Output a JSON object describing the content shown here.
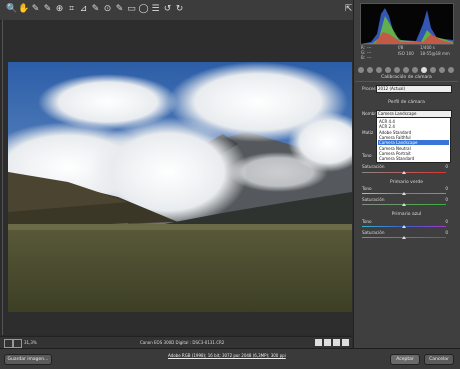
{
  "toolbar": {
    "tools": [
      "zoom-tool",
      "hand-tool",
      "white-balance-tool",
      "color-sampler-tool",
      "targeted-adjustment-tool",
      "crop-tool",
      "straighten-tool",
      "spot-removal-tool",
      "red-eye-tool",
      "adjustment-brush-tool",
      "graduated-filter-tool",
      "radial-filter-tool",
      "preferences-tool",
      "rotate-ccw-tool",
      "rotate-cw-tool"
    ],
    "tool_glyphs": [
      "🔍",
      "✋",
      "✎",
      "✎",
      "⊕",
      "⌗",
      "⊿",
      "✎",
      "⊙",
      "✎",
      "▭",
      "◯",
      "☰",
      "↺",
      "↻"
    ]
  },
  "histogram": {
    "r_label": "R:",
    "g_label": "G:",
    "b_label": "B:",
    "r_value": "---",
    "g_value": "---",
    "b_value": "---",
    "f_value": "f/8",
    "iso_value": "ISO 100",
    "shutter_value": "1/400 s",
    "focal_value": "18-55@18 mm"
  },
  "panel": {
    "section_title": "Calibración de cámara",
    "process_label": "Proceso:",
    "process_value": "2012 (Actual)",
    "profile_title": "Perfil de cámara",
    "name_label": "Nombre:",
    "name_value": "Camera Landscape",
    "tint_label": "Matiz",
    "tone_label": "Tono",
    "saturation_label": "Saturación",
    "red_sat_value": "0",
    "green_primary_title": "Primario verde",
    "green_tone_value": "0",
    "green_sat_value": "0",
    "blue_primary_title": "Primario azul",
    "blue_tone_value": "0",
    "blue_sat_value": "0"
  },
  "dropdown": {
    "options": [
      "ACR 4.4",
      "ACR 2.4",
      "Adobe Standard",
      "Camera Faithful",
      "Camera Landscape",
      "Camera Neutral",
      "Camera Portrait",
      "Camera Standard"
    ],
    "selected_index": 4
  },
  "status": {
    "zoom": "31,3%",
    "camera": "Canon EOS 300D Digital : DSC3-0131.CR2"
  },
  "footer": {
    "save_label": "Guardar imagen...",
    "workflow_link": "Adobe RGB (1998); 16 bit; 3072 por 2048 (6,3MP); 300 ppi",
    "accept_label": "Aceptar",
    "cancel_label": "Cancelar"
  },
  "colors": {
    "selected_option": "#3875d7",
    "panel_bg": "#3f3f3f"
  }
}
